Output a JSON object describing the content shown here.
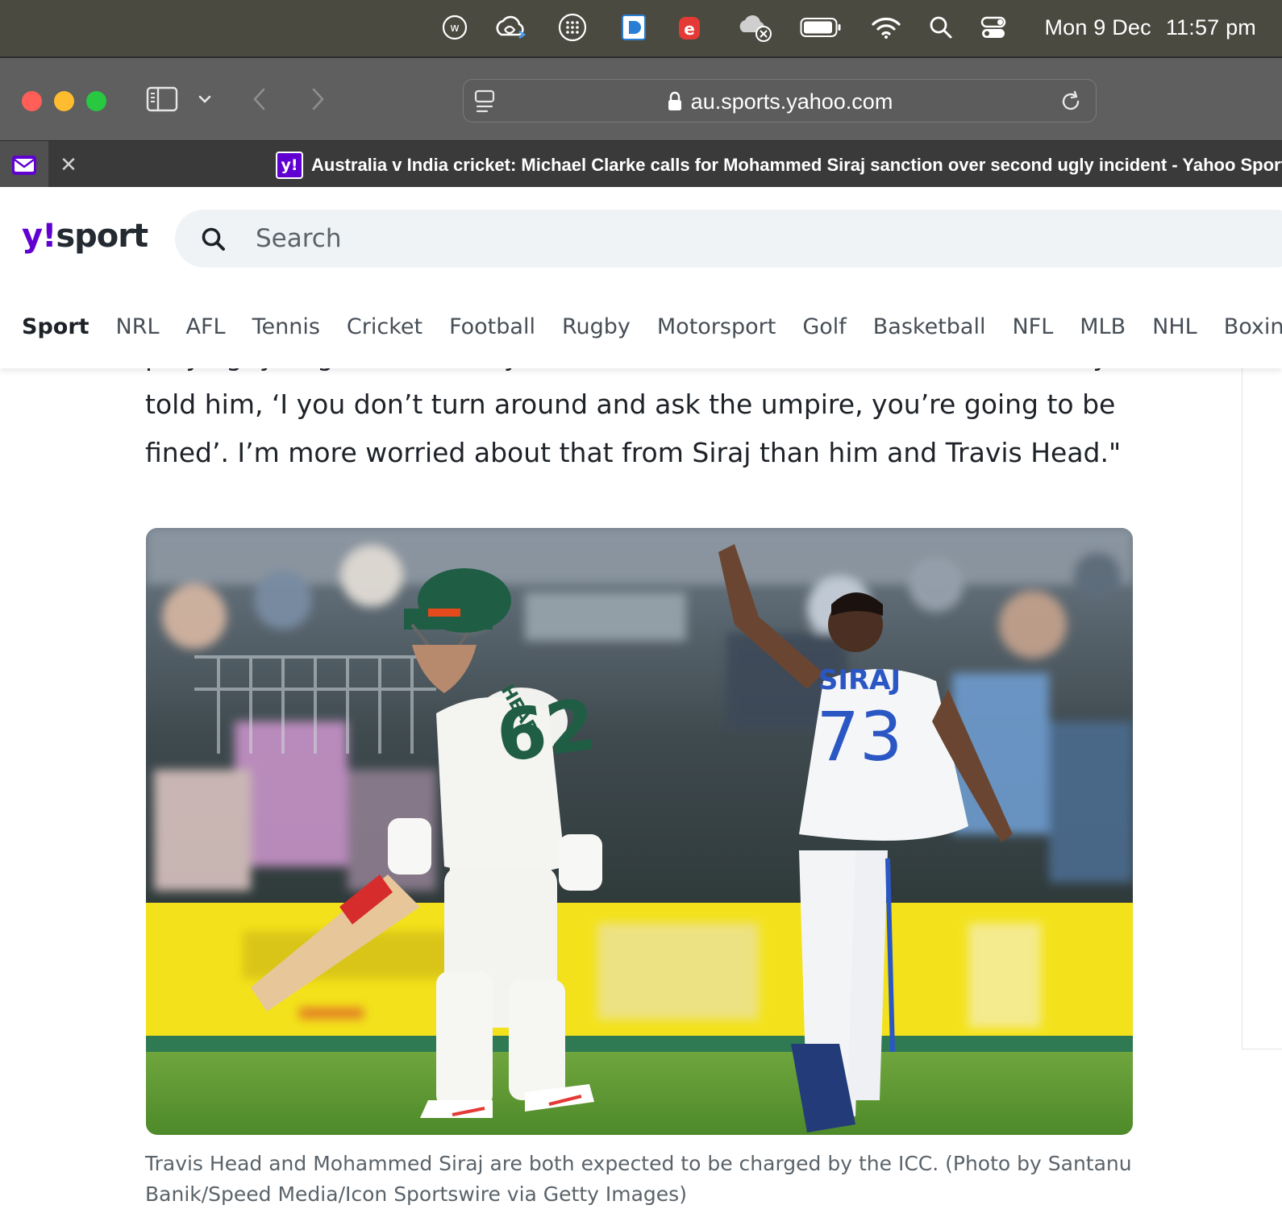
{
  "menubar": {
    "date": "Mon 9 Dec",
    "time": "11:57 pm",
    "icons": [
      "w-circle-icon",
      "creative-cloud-icon",
      "launchpad-icon",
      "dash-icon",
      "e-app-icon",
      "cloud-error-icon",
      "battery-icon",
      "wifi-icon",
      "spotlight-icon",
      "control-center-icon"
    ]
  },
  "browser": {
    "url": "au.sports.yahoo.com",
    "tab_title": "Australia v India cricket: Michael Clarke calls for Mohammed Siraj sanction over second ugly incident - Yahoo Sport",
    "favicon_text": "y!"
  },
  "site": {
    "logo_y": "y!",
    "logo_text": "sport",
    "search_placeholder": "Search",
    "nav": [
      "Sport",
      "NRL",
      "AFL",
      "Tennis",
      "Cricket",
      "Football",
      "Rugby",
      "Motorsport",
      "Golf",
      "Basketball",
      "NFL",
      "MLB",
      "NHL",
      "Boxing"
    ],
    "active_nav": "Sport"
  },
  "article": {
    "paragraph_lines": [
      "playing, you get fined every time. Brett Lee was the worst at it and they",
      "told him, ‘I you don’t turn around and ask the umpire, you’re going to be",
      "fined’. I’m more worried about that from Siraj than him and Travis Head.\""
    ],
    "photo": {
      "jersey_left_name": "HEAD",
      "jersey_left_number": "62",
      "jersey_right_name": "SIRAJ",
      "jersey_right_number": "73"
    },
    "caption_lines": [
      "Travis Head and Mohammed Siraj are both expected to be charged by the ICC. (Photo by Santanu",
      "Banik/Speed Media/Icon Sportswire via Getty Images)"
    ]
  },
  "colors": {
    "brand": "#6001d2",
    "menubar": "#4b4a40",
    "chrome": "#5f5f5f"
  }
}
